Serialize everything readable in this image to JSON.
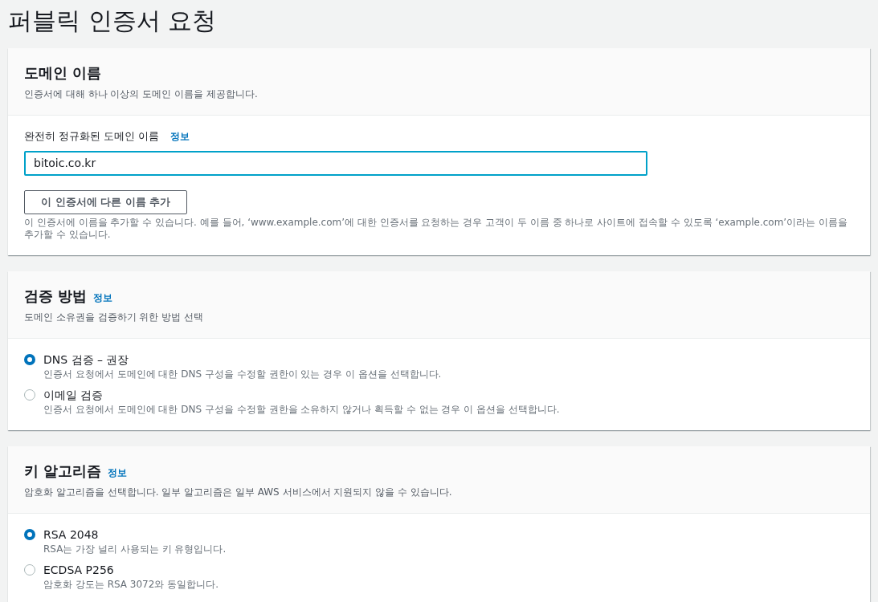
{
  "page_title": "퍼블릭 인증서 요청",
  "domain_section": {
    "title": "도메인 이름",
    "description": "인증서에 대해 하나 이상의 도메인 이름을 제공합니다.",
    "field_label": "완전히 정규화된 도메인 이름",
    "info_link": "정보",
    "field_value": "bitoic.co.kr",
    "add_button": "이 인증서에 다른 이름 추가",
    "help_text": "이 인증서에 이름을 추가할 수 있습니다. 예를 들어, ‘www.example.com’에 대한 인증서를 요청하는 경우 고객이 두 이름 중 하나로 사이트에 접속할 수 있도록 ‘example.com’이라는 이름을 추가할 수 있습니다."
  },
  "validation_section": {
    "title": "검증 방법",
    "info_link": "정보",
    "description": "도메인 소유권을 검증하기 위한 방법 선택",
    "options": [
      {
        "label": "DNS 검증 – 권장",
        "description": "인증서 요청에서 도메인에 대한 DNS 구성을 수정할 권한이 있는 경우 이 옵션을 선택합니다.",
        "selected": true
      },
      {
        "label": "이메일 검증",
        "description": "인증서 요청에서 도메인에 대한 DNS 구성을 수정할 권한을 소유하지 않거나 획득할 수 없는 경우 이 옵션을 선택합니다.",
        "selected": false
      }
    ]
  },
  "key_section": {
    "title": "키 알고리즘",
    "info_link": "정보",
    "description": "암호화 알고리즘을 선택합니다. 일부 알고리즘은 일부 AWS 서비스에서 지원되지 않을 수 있습니다.",
    "options": [
      {
        "label": "RSA 2048",
        "description": "RSA는 가장 널리 사용되는 키 유형입니다.",
        "selected": true
      },
      {
        "label": "ECDSA P256",
        "description": "암호화 강도는 RSA 3072와 동일합니다.",
        "selected": false
      }
    ]
  }
}
